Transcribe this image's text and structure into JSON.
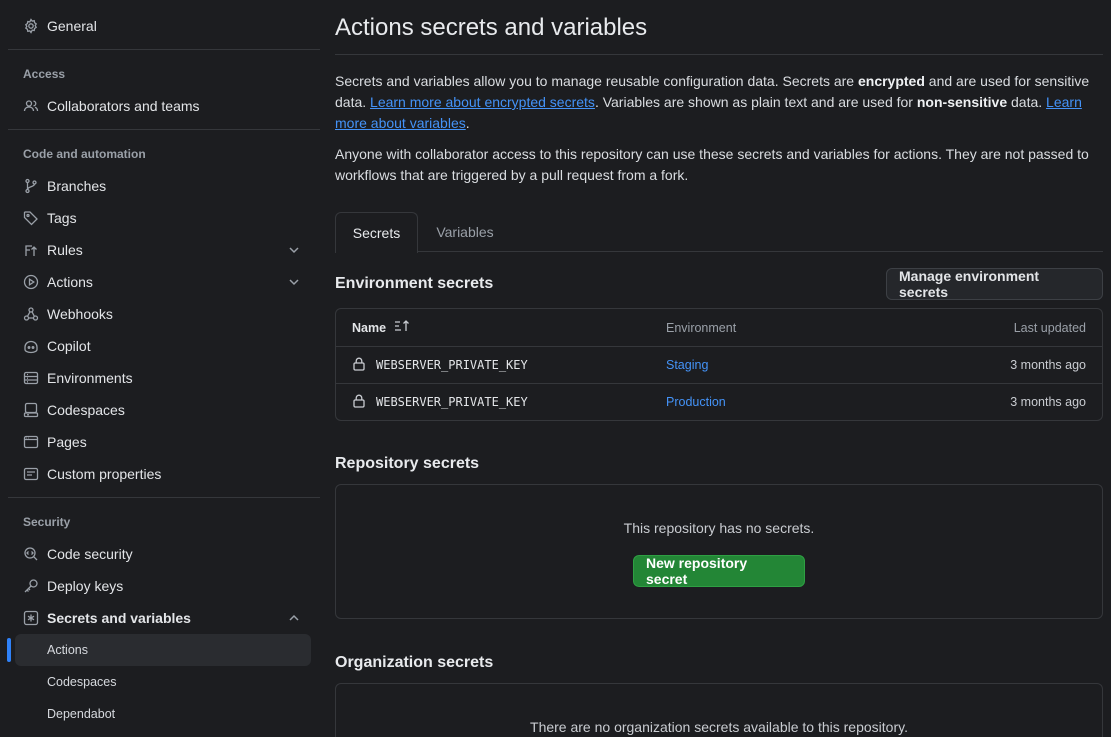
{
  "sidebar": {
    "general": "General",
    "sections": {
      "access": "Access",
      "code_automation": "Code and automation",
      "security": "Security"
    },
    "items": {
      "collaborators": "Collaborators and teams",
      "branches": "Branches",
      "tags": "Tags",
      "rules": "Rules",
      "actions": "Actions",
      "webhooks": "Webhooks",
      "copilot": "Copilot",
      "environments": "Environments",
      "codespaces": "Codespaces",
      "pages": "Pages",
      "custom_properties": "Custom properties",
      "code_security": "Code security",
      "deploy_keys": "Deploy keys",
      "secrets_variables": "Secrets and variables"
    },
    "sub_items": {
      "actions": "Actions",
      "codespaces": "Codespaces",
      "dependabot": "Dependabot"
    }
  },
  "main": {
    "title": "Actions secrets and variables",
    "intro": {
      "t1": "Secrets and variables allow you to manage reusable configuration data. Secrets are ",
      "b1": "encrypted",
      "t2": " and are used for sensitive data. ",
      "link1": "Learn more about encrypted secrets",
      "t3": ". Variables are shown as plain text and are used for ",
      "b2": "non-sensitive",
      "t4": " data. ",
      "link2": "Learn more about variables",
      "t5": "."
    },
    "access_note": "Anyone with collaborator access to this repository can use these secrets and variables for actions. They are not passed to workflows that are triggered by a pull request from a fork.",
    "tabs": [
      "Secrets",
      "Variables"
    ],
    "environment_secrets": {
      "heading": "Environment secrets",
      "manage_button": "Manage environment secrets",
      "columns": [
        "Name",
        "Environment",
        "Last updated"
      ],
      "rows": [
        {
          "name": "WEBSERVER_PRIVATE_KEY",
          "environment": "Staging",
          "updated": "3 months ago"
        },
        {
          "name": "WEBSERVER_PRIVATE_KEY",
          "environment": "Production",
          "updated": "3 months ago"
        }
      ]
    },
    "repository_secrets": {
      "heading": "Repository secrets",
      "empty": "This repository has no secrets.",
      "new_button": "New repository secret"
    },
    "organization_secrets": {
      "heading": "Organization secrets",
      "empty": "There are no organization secrets available to this repository."
    }
  }
}
